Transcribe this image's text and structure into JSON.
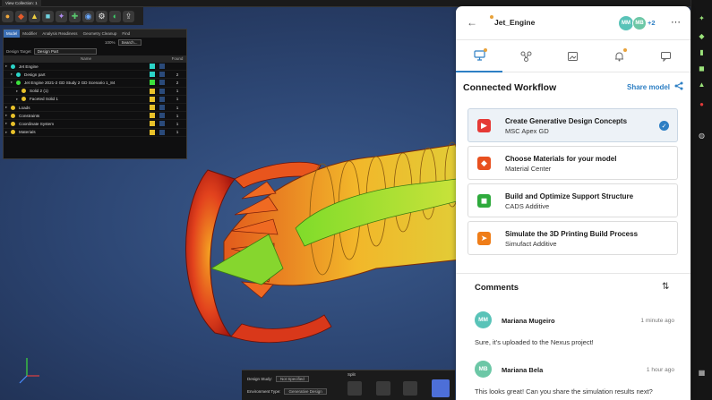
{
  "app": {
    "top_tab": "View Collection: 1"
  },
  "model_tree": {
    "tabs": [
      "Model",
      "Modifier",
      "Analysis Readiness",
      "Geometry Cleanup",
      "Find"
    ],
    "zoom": "100%",
    "search_placeholder": "Search...",
    "design_target_label": "Design Target",
    "design_target_value": "Design Part",
    "col_name": "Name",
    "col_found": "Found",
    "rows": [
      {
        "name": "Jet Engine",
        "indent": 0,
        "found": "",
        "color": "#2bd4c8"
      },
      {
        "name": "Design part",
        "indent": 1,
        "found": "2",
        "color": "#2bd4c8"
      },
      {
        "name": "Jet Engine 2021-2 GD Study 2 GD Scenario 1_84",
        "indent": 1,
        "found": "2",
        "color": "#3ce03c"
      },
      {
        "name": "Solid 2 (1)",
        "indent": 2,
        "found": "1",
        "color": "#e8c12a"
      },
      {
        "name": "Faceted Solid 1",
        "indent": 2,
        "found": "1",
        "color": "#e8c12a"
      },
      {
        "name": "Loads",
        "indent": 0,
        "found": "1",
        "color": "#e8c12a"
      },
      {
        "name": "Constraints",
        "indent": 0,
        "found": "1",
        "color": "#e8c12a"
      },
      {
        "name": "Coordinate System",
        "indent": 0,
        "found": "1",
        "color": "#e8c12a"
      },
      {
        "name": "Materials",
        "indent": 0,
        "found": "1",
        "color": "#e8c12a"
      }
    ]
  },
  "bottom_strip": {
    "design_study_label": "Design Study:",
    "design_study_value": "Not Specified",
    "environment_label": "Environment Type:",
    "environment_value": "Generative Design",
    "section_label": "Split"
  },
  "panel": {
    "project_title": "Jet_Engine",
    "avatars": [
      {
        "initials": "MM",
        "color": "#59c3b8"
      },
      {
        "initials": "MB",
        "color": "#6cc7a6"
      }
    ],
    "avatar_more": "+2",
    "workflow_title": "Connected Workflow",
    "share_label": "Share model",
    "steps": [
      {
        "title": "Create Generative Design Concepts",
        "subtitle": "MSC Apex GD",
        "icon": "apex-gd-icon",
        "color": "#e53935",
        "selected": true
      },
      {
        "title": "Choose Materials for your model",
        "subtitle": "Material Center",
        "icon": "material-center-icon",
        "color": "#e8501f",
        "selected": false
      },
      {
        "title": "Build and Optimize Support Structure",
        "subtitle": "CADS Additive",
        "icon": "cads-additive-icon",
        "color": "#2eaa3c",
        "selected": false
      },
      {
        "title": "Simulate the 3D Printing Build Process",
        "subtitle": "Simufact Additive",
        "icon": "simufact-icon",
        "color": "#ef7d18",
        "selected": false
      }
    ],
    "comments_title": "Comments",
    "comments": [
      {
        "initials": "MM",
        "avatar_color": "#59c3b8",
        "name": "Mariana Mugeiro",
        "time": "1 minute ago",
        "text": "Sure, it's uploaded to the Nexus project!"
      },
      {
        "initials": "MB",
        "avatar_color": "#6cc7a6",
        "name": "Mariana Bela",
        "time": "1 hour ago",
        "text": "This looks great! Can you share the simulation results next?"
      }
    ]
  }
}
